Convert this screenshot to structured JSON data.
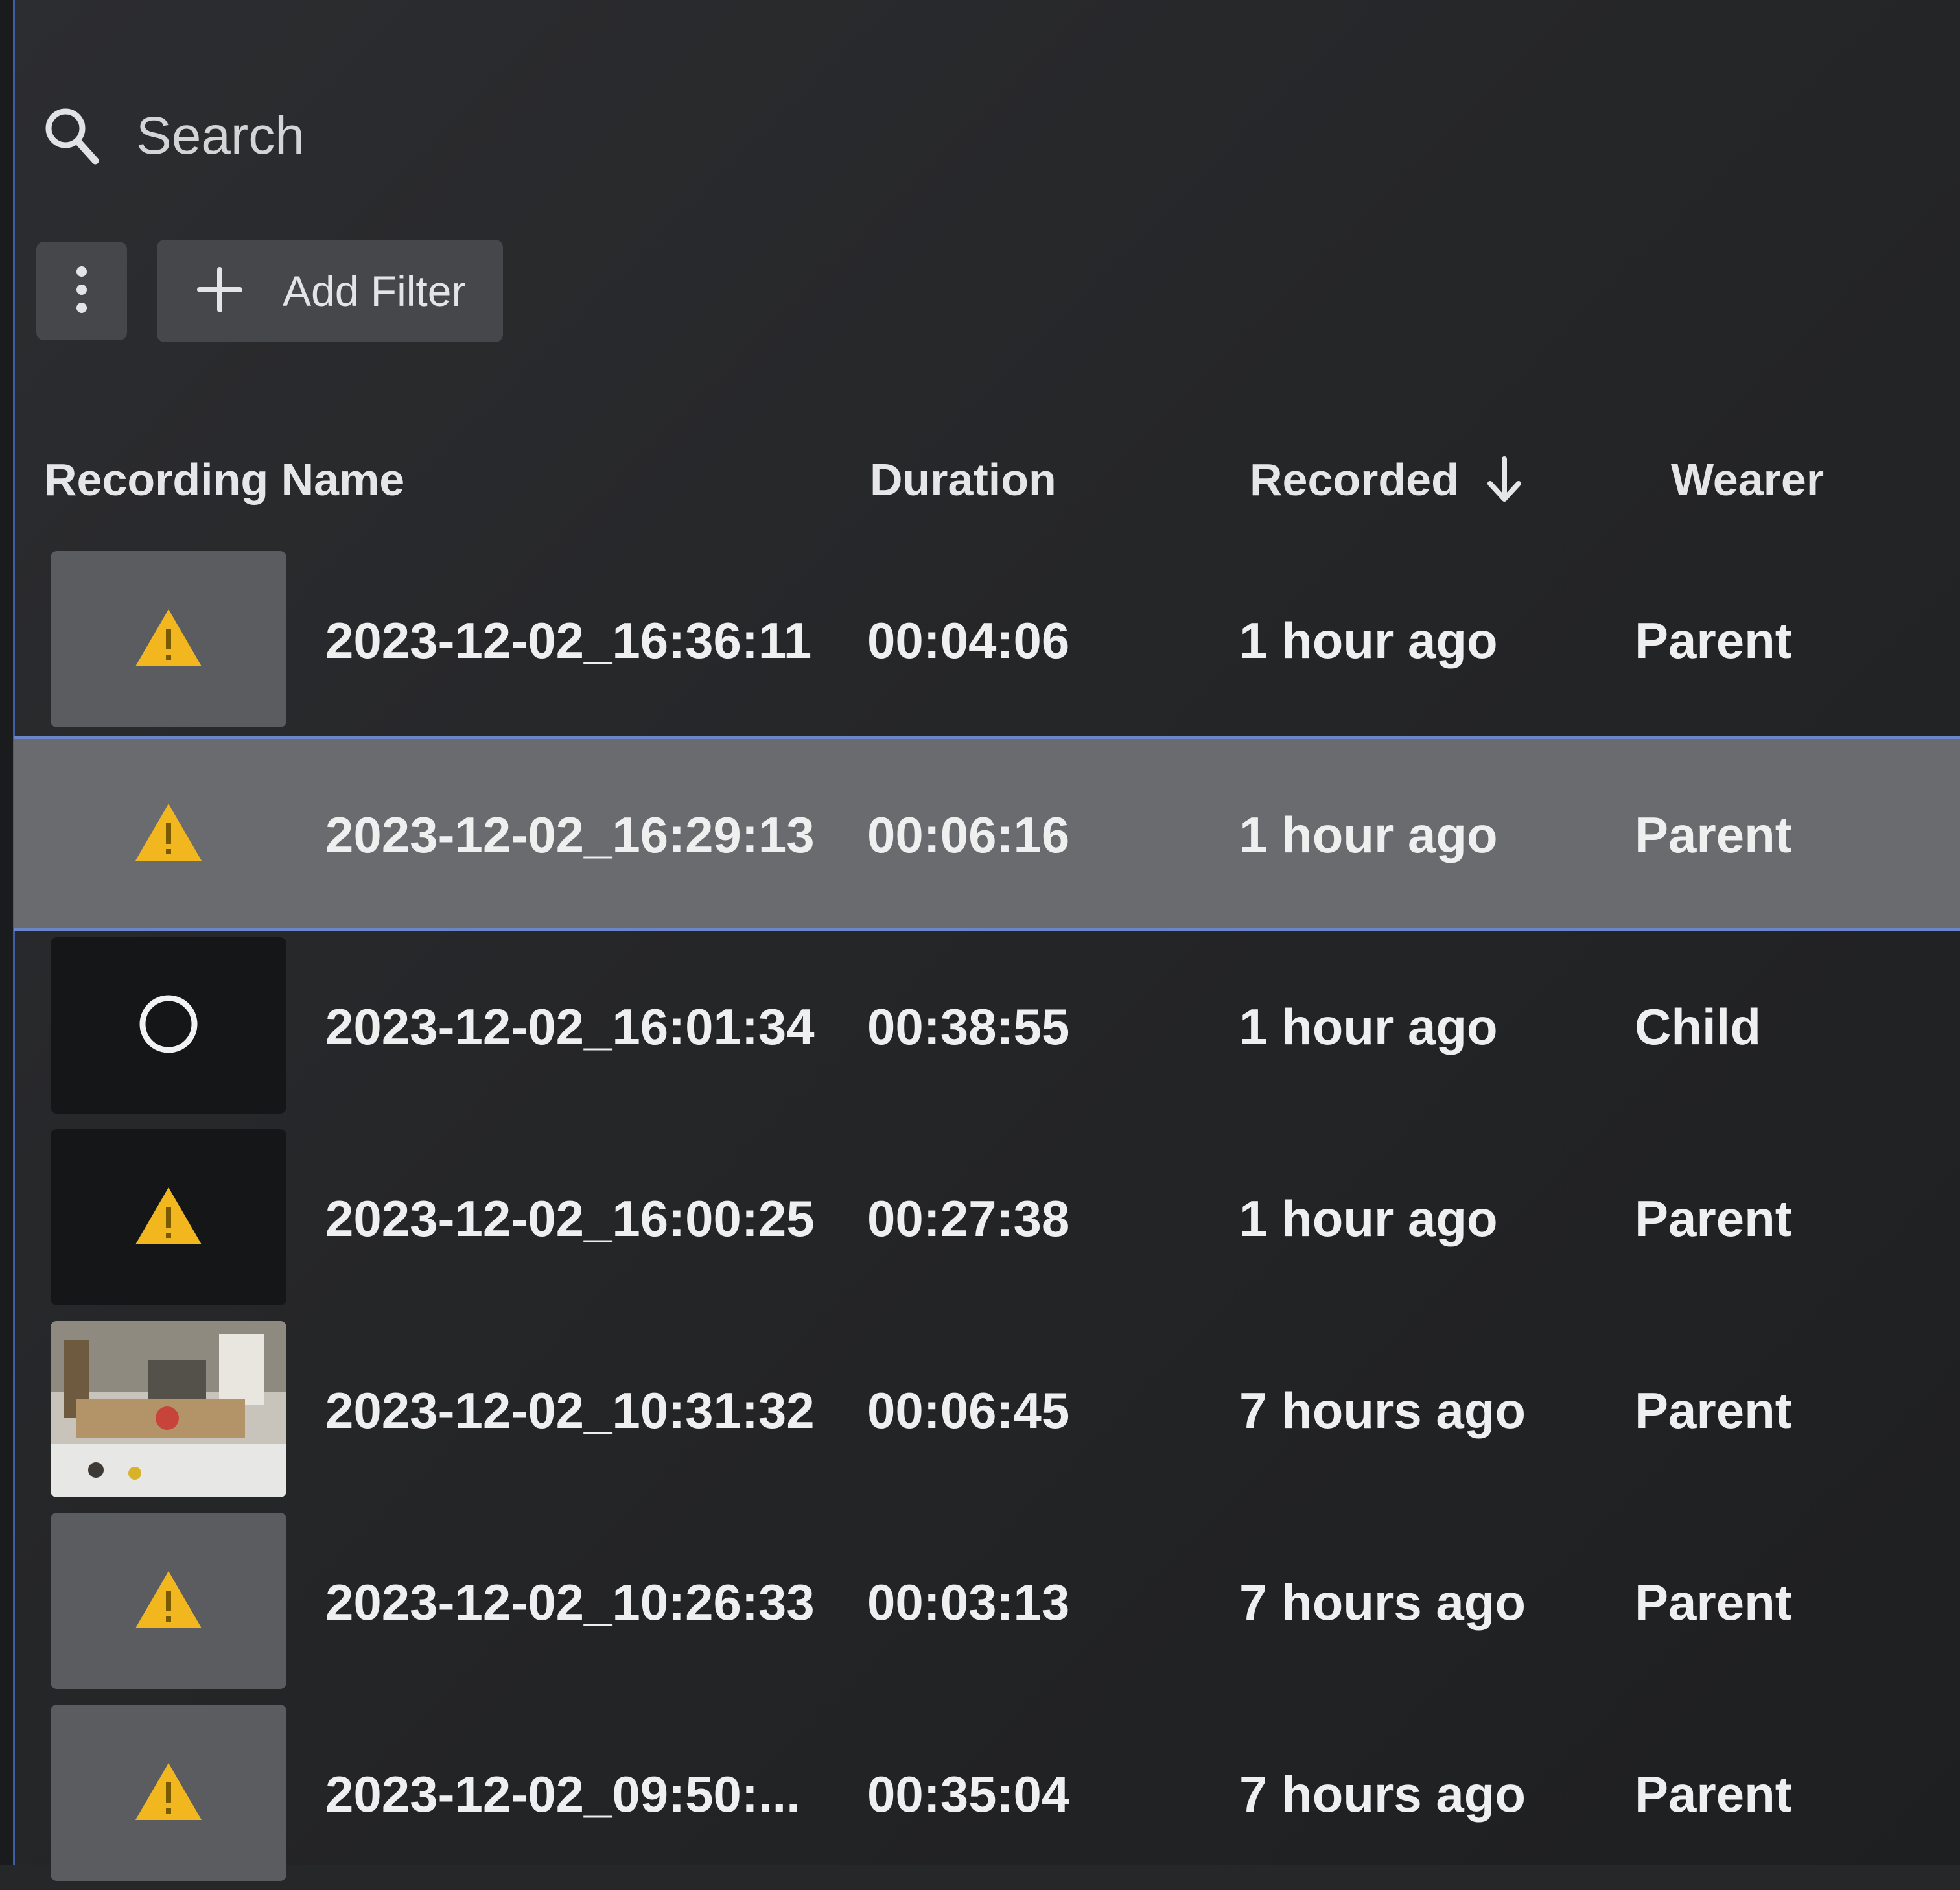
{
  "search": {
    "placeholder": "Search"
  },
  "toolbar": {
    "add_filter_label": "Add Filter"
  },
  "table": {
    "columns": {
      "name": "Recording Name",
      "duration": "Duration",
      "recorded": "Recorded",
      "wearer": "Wearer"
    },
    "sort": {
      "column": "recorded",
      "direction": "descending"
    },
    "rows": [
      {
        "name": "2023-12-02_16:36:11",
        "duration": "00:04:06",
        "recorded": "1 hour ago",
        "wearer": "Parent",
        "thumbnail": "warning-icon"
      },
      {
        "name": "2023-12-02_16:29:13",
        "duration": "00:06:16",
        "recorded": "1 hour ago",
        "wearer": "Parent",
        "thumbnail": "warning-icon"
      },
      {
        "name": "2023-12-02_16:01:34",
        "duration": "00:38:55",
        "recorded": "1 hour ago",
        "wearer": "Child",
        "thumbnail": "loading-ring-icon"
      },
      {
        "name": "2023-12-02_16:00:25",
        "duration": "00:27:38",
        "recorded": "1 hour ago",
        "wearer": "Parent",
        "thumbnail": "warning-icon"
      },
      {
        "name": "2023-12-02_10:31:32",
        "duration": "00:06:45",
        "recorded": "7 hours ago",
        "wearer": "Parent",
        "thumbnail": "scene-preview"
      },
      {
        "name": "2023-12-02_10:26:33",
        "duration": "00:03:13",
        "recorded": "7 hours ago",
        "wearer": "Parent",
        "thumbnail": "warning-icon"
      },
      {
        "name": "2023-12-02_09:50:...",
        "duration": "00:35:04",
        "recorded": "7 hours ago",
        "wearer": "Parent",
        "thumbnail": "warning-icon"
      }
    ]
  },
  "colors": {
    "background": "#262729",
    "button": "#46474b",
    "selected_row": "#6a6b6e",
    "selection_border": "#6a86c9",
    "warning": "#f2b71f"
  }
}
